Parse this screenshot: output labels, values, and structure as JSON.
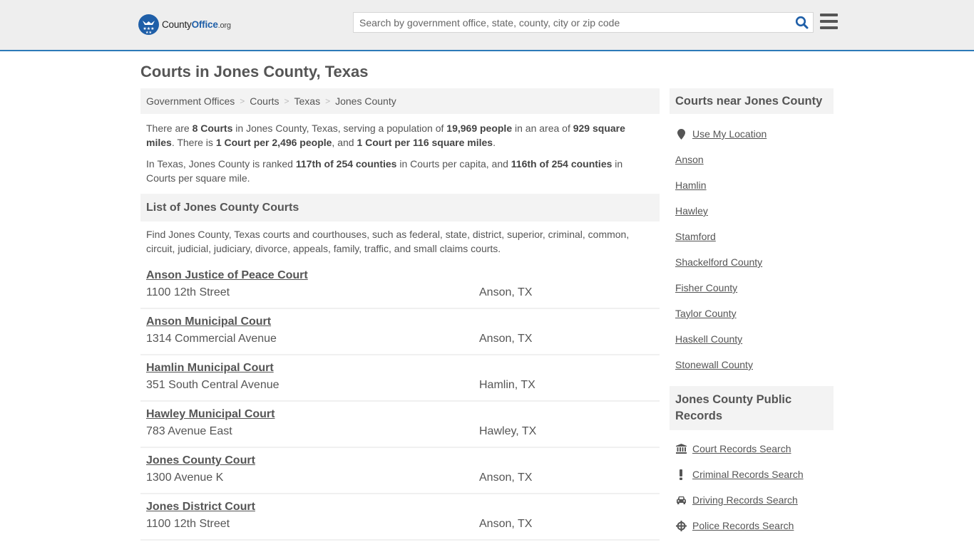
{
  "header": {
    "logo": {
      "prefix": "County",
      "brand": "Office",
      "suffix": ".org"
    },
    "search_placeholder": "Search by government office, state, county, city or zip code",
    "search_icon": "search-icon",
    "menu_icon": "hamburger-menu-icon"
  },
  "page_title": "Courts in Jones County, Texas",
  "breadcrumb": [
    "Government Offices",
    "Courts",
    "Texas",
    "Jones County"
  ],
  "intro": {
    "p1": {
      "t1": "There are ",
      "b1": "8 Courts",
      "t2": " in Jones County, Texas, serving a population of ",
      "b2": "19,969 people",
      "t3": " in an area of ",
      "b3": "929 square miles",
      "t4": ". There is ",
      "b4": "1 Court per 2,496 people",
      "t5": ", and ",
      "b5": "1 Court per 116 square miles",
      "t6": "."
    },
    "p2": {
      "t1": "In Texas, Jones County is ranked ",
      "b1": "117th of 254 counties",
      "t2": " in Courts per capita, and ",
      "b2": "116th of 254 counties",
      "t3": " in Courts per square mile."
    }
  },
  "list_section": {
    "title": "List of Jones County Courts",
    "description": "Find Jones County, Texas courts and courthouses, such as federal, state, district, superior, criminal, common, circuit, judicial, judiciary, divorce, appeals, family, traffic, and small claims courts.",
    "courts": [
      {
        "name": "Anson Justice of Peace Court",
        "address": "1100 12th Street",
        "city": "Anson, TX"
      },
      {
        "name": "Anson Municipal Court",
        "address": "1314 Commercial Avenue",
        "city": "Anson, TX"
      },
      {
        "name": "Hamlin Municipal Court",
        "address": "351 South Central Avenue",
        "city": "Hamlin, TX"
      },
      {
        "name": "Hawley Municipal Court",
        "address": "783 Avenue East",
        "city": "Hawley, TX"
      },
      {
        "name": "Jones County Court",
        "address": "1300 Avenue K",
        "city": "Anson, TX"
      },
      {
        "name": "Jones District Court",
        "address": "1100 12th Street",
        "city": "Anson, TX"
      }
    ]
  },
  "sidebar": {
    "nearby_title": "Courts near Jones County",
    "use_location": "Use My Location",
    "nearby": [
      "Anson",
      "Hamlin",
      "Hawley",
      "Stamford",
      "Shackelford County",
      "Fisher County",
      "Taylor County",
      "Haskell County",
      "Stonewall County"
    ],
    "records_title": "Jones County Public Records",
    "records": [
      {
        "label": "Court Records Search",
        "icon": "courthouse-icon"
      },
      {
        "label": "Criminal Records Search",
        "icon": "exclamation-icon"
      },
      {
        "label": "Driving Records Search",
        "icon": "car-icon"
      },
      {
        "label": "Police Records Search",
        "icon": "crosshair-icon"
      }
    ]
  },
  "colors": {
    "brand_blue": "#1f5fa8",
    "header_border": "#2c7ab8",
    "text": "#555555"
  }
}
